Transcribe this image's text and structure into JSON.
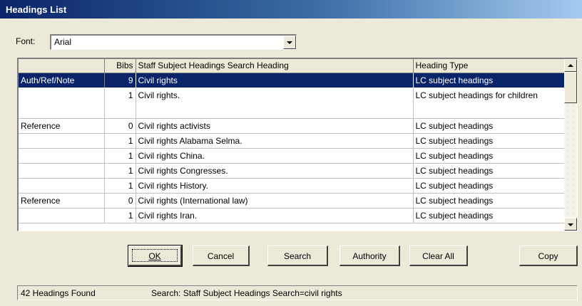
{
  "window": {
    "title": "Headings List"
  },
  "font": {
    "label": "Font:",
    "value": "Arial"
  },
  "grid": {
    "columns": [
      "",
      "Bibs",
      "Staff Subject Headings Search Heading",
      "Heading Type"
    ],
    "rows": [
      {
        "source": "Auth/Ref/Note",
        "bibs": "9",
        "heading": "Civil rights",
        "type": "LC subject headings",
        "selected": true
      },
      {
        "source": "",
        "bibs": "1",
        "heading": "Civil rights.",
        "type": "LC subject headings for children",
        "selected": false
      },
      {
        "source": "Reference",
        "bibs": "0",
        "heading": "Civil rights activists",
        "type": "LC subject headings",
        "selected": false
      },
      {
        "source": "",
        "bibs": "1",
        "heading": "Civil rights Alabama Selma.",
        "type": "LC subject headings",
        "selected": false
      },
      {
        "source": "",
        "bibs": "1",
        "heading": "Civil rights China.",
        "type": "LC subject headings",
        "selected": false
      },
      {
        "source": "",
        "bibs": "1",
        "heading": "Civil rights Congresses.",
        "type": "LC subject headings",
        "selected": false
      },
      {
        "source": "",
        "bibs": "1",
        "heading": "Civil rights History.",
        "type": "LC subject headings",
        "selected": false
      },
      {
        "source": "Reference",
        "bibs": "0",
        "heading": "Civil rights (International law)",
        "type": "LC subject headings",
        "selected": false
      },
      {
        "source": "",
        "bibs": "1",
        "heading": "Civil rights Iran.",
        "type": "LC subject headings",
        "selected": false
      }
    ]
  },
  "buttons": {
    "ok": "OK",
    "cancel": "Cancel",
    "search": "Search",
    "authority": "Authority",
    "clear_all": "Clear All",
    "copy": "Copy"
  },
  "status": {
    "count": "42 Headings Found",
    "search": "Search: Staff Subject Headings Search=civil rights"
  },
  "icons": {
    "combo_dropdown": "chevron-down-icon",
    "scroll_up": "scroll-up-arrow-icon",
    "scroll_down": "scroll-down-arrow-icon"
  },
  "colors": {
    "titlebar_start": "#0a246a",
    "titlebar_end": "#a6caf0",
    "selection": "#0a246a",
    "dialog_face": "#ece9d8"
  }
}
